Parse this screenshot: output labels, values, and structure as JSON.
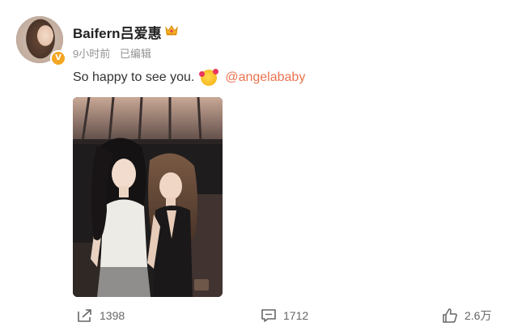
{
  "post": {
    "author": {
      "name": "Baifern吕爱惠",
      "verified_mark": "V",
      "badge_icon": "crown-icon",
      "avatar_icon": "avatar"
    },
    "meta": {
      "time": "9小时前",
      "edited": "已编辑"
    },
    "text": {
      "message": "So happy to see you.",
      "emoji_icon": "smiling-face-with-hearts-icon",
      "mention": "@angelababy"
    },
    "image": {
      "icon": "photo"
    },
    "actions": {
      "repost_count": "1398",
      "comment_count": "1712",
      "like_count": "2.6万"
    }
  },
  "colors": {
    "mention": "#eb7350",
    "verified": "#f5a623",
    "meta_text": "#939393",
    "action_text": "#666666"
  }
}
